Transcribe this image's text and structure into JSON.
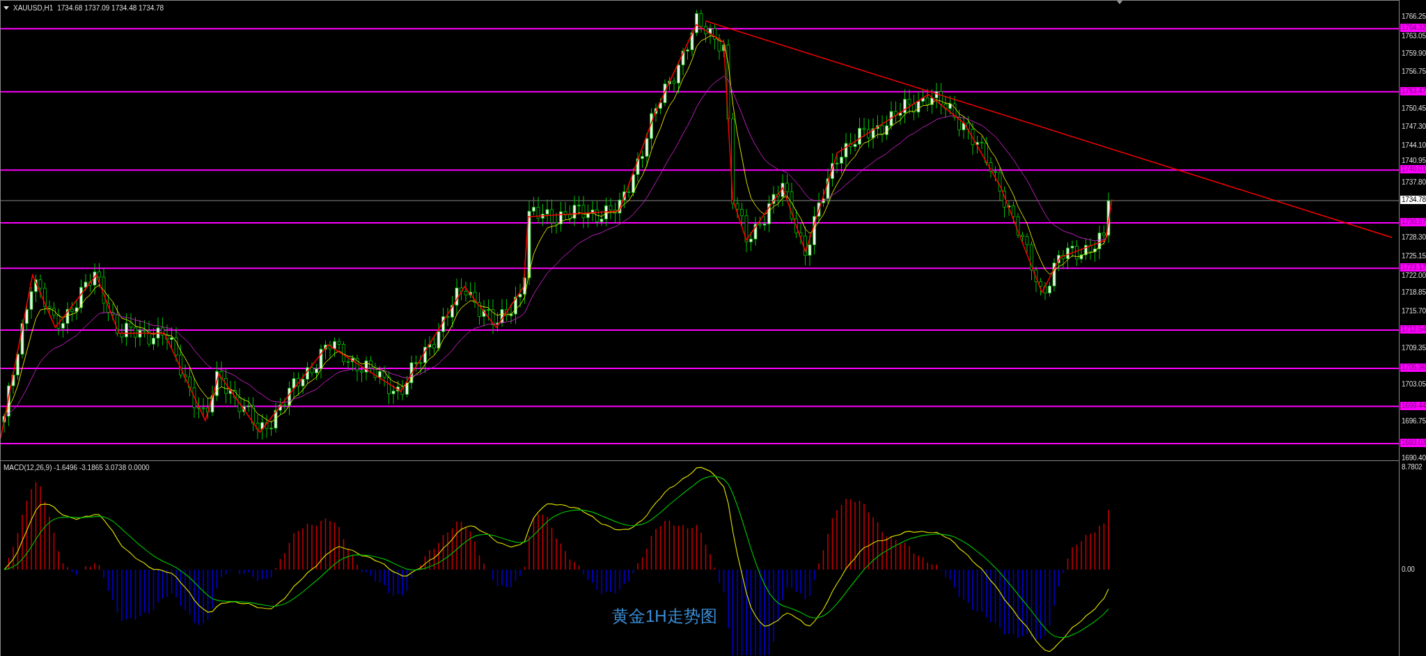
{
  "header": {
    "symbol": "XAUUSD,H1",
    "ohlc": "1734.68 1737.09 1734.48 1734.78"
  },
  "price_axis": {
    "ticks": [
      "1766.25",
      "1763.05",
      "1759.90",
      "1756.75",
      "1750.45",
      "1747.30",
      "1744.10",
      "1740.95",
      "1737.80",
      "1728.30",
      "1725.15",
      "1722.00",
      "1718.85",
      "1715.70",
      "1709.35",
      "1703.05",
      "1696.75",
      "1690.40"
    ],
    "levels": [
      "1764.32",
      "1753.47",
      "1740.01",
      "1730.97",
      "1723.17",
      "1712.54",
      "1705.96",
      "1699.44",
      "1693.03"
    ],
    "current_price": "1734.78"
  },
  "macd": {
    "title": "MACD(12,26,9) -1.6496 -3.1865 3.0738 0.0000",
    "axis_labels": [
      "8.7802",
      "0.00"
    ]
  },
  "caption": "黄金1H走势图"
}
